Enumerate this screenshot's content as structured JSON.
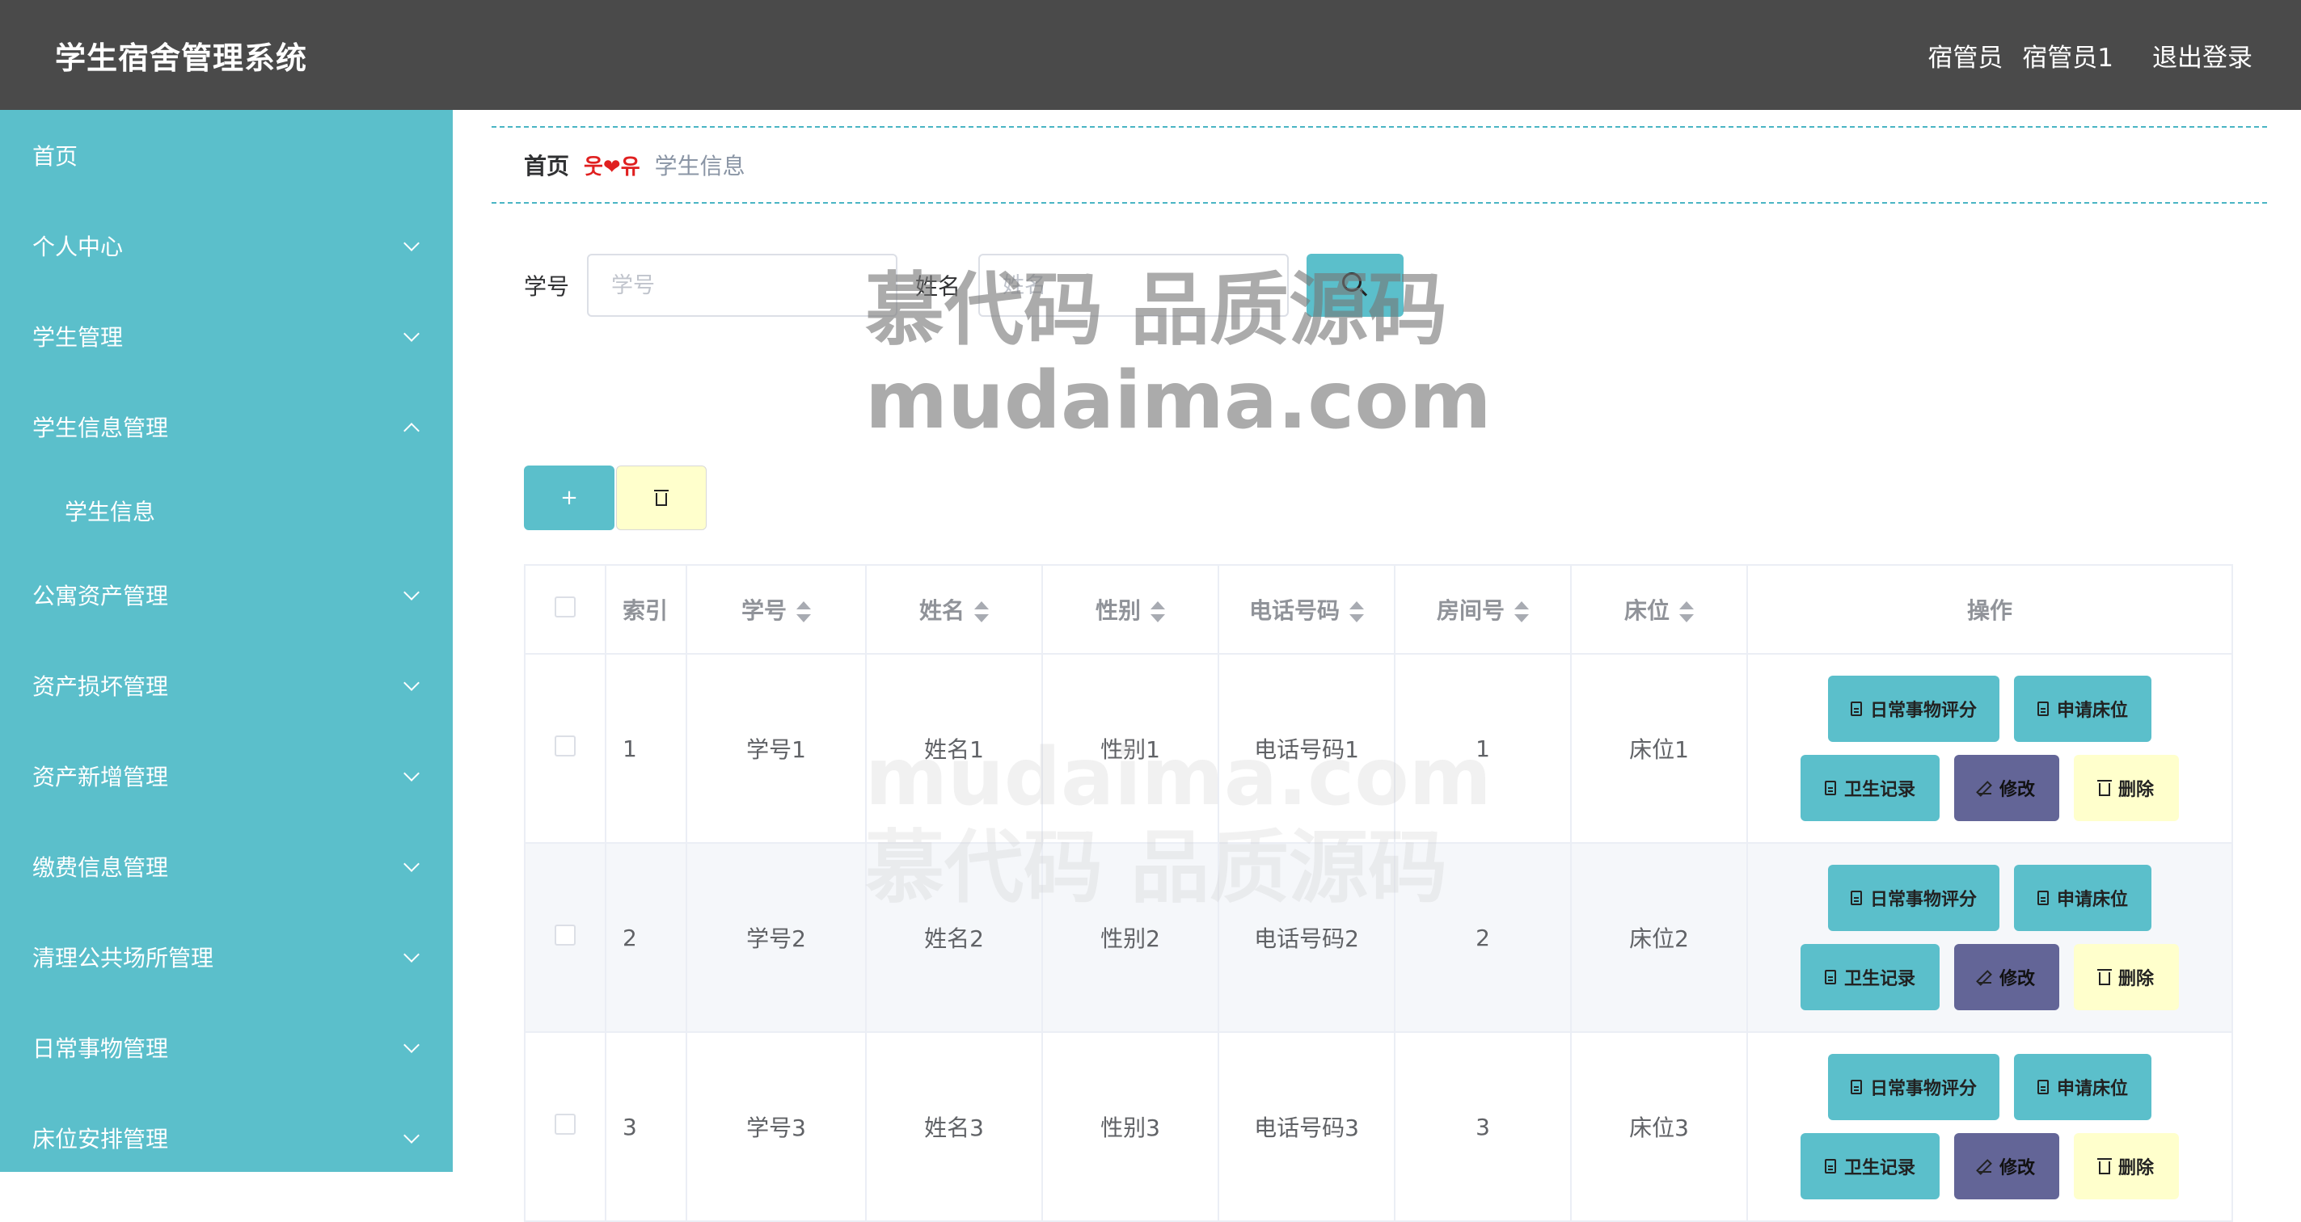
{
  "header": {
    "title": "学生宿舍管理系统",
    "role": "宿管员",
    "username": "宿管员1",
    "logout_label": "退出登录"
  },
  "sidebar": {
    "items": [
      {
        "label": "首页"
      },
      {
        "label": "个人中心"
      },
      {
        "label": "学生管理"
      },
      {
        "label": "学生信息管理"
      },
      {
        "label": "学生信息"
      },
      {
        "label": "公寓资产管理"
      },
      {
        "label": "资产损坏管理"
      },
      {
        "label": "资产新增管理"
      },
      {
        "label": "缴费信息管理"
      },
      {
        "label": "清理公共场所管理"
      },
      {
        "label": "日常事物管理"
      },
      {
        "label": "床位安排管理"
      }
    ]
  },
  "breadcrumb": {
    "home": "首页",
    "separator": "웃❤유",
    "current": "学生信息"
  },
  "search": {
    "student_id_label": "学号",
    "student_id_placeholder": "学号",
    "name_label": "姓名",
    "name_placeholder": "姓名"
  },
  "actions": {
    "add_symbol": "+"
  },
  "table": {
    "headers": {
      "index": "索引",
      "student_id": "学号",
      "name": "姓名",
      "gender": "性别",
      "phone": "电话号码",
      "room": "房间号",
      "bed": "床位",
      "ops": "操作"
    },
    "rows": [
      {
        "index": "1",
        "student_id": "学号1",
        "name": "姓名1",
        "gender": "性别1",
        "phone": "电话号码1",
        "room": "1",
        "bed": "床位1"
      },
      {
        "index": "2",
        "student_id": "学号2",
        "name": "姓名2",
        "gender": "性别2",
        "phone": "电话号码2",
        "room": "2",
        "bed": "床位2"
      },
      {
        "index": "3",
        "student_id": "学号3",
        "name": "姓名3",
        "gender": "性别3",
        "phone": "电话号码3",
        "room": "3",
        "bed": "床位3"
      }
    ],
    "row_buttons": {
      "daily_score": "日常事物评分",
      "apply_bed": "申请床位",
      "hygiene": "卫生记录",
      "edit": "修改",
      "delete": "删除"
    }
  },
  "watermark": {
    "line1": "慕代码 品质源码",
    "line2": "mudaima.com"
  },
  "colors": {
    "header_bg": "#4a4a4a",
    "sidebar_bg": "#5bbfcb",
    "accent_teal": "#5bbfcb",
    "edit_purple": "#636597",
    "delete_yellow": "#ffffcc"
  }
}
